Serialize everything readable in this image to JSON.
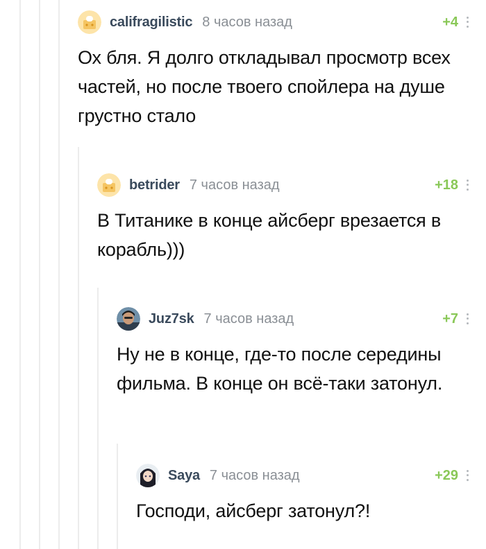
{
  "comments": [
    {
      "username": "califragilistic",
      "time": "8 часов назад",
      "rating": "+4",
      "text": "Ох бля. Я долго откладывал просмотр всех частей, но после твоего спойлера на душе грустно стало",
      "avatar": "default-avatar"
    },
    {
      "username": "betrider",
      "time": "7 часов назад",
      "rating": "+18",
      "text": "В Титанике в конце айсберг врезается в корабль)))",
      "avatar": "default-avatar"
    },
    {
      "username": "Juz7sk",
      "time": "7 часов назад",
      "rating": "+7",
      "text": "Ну не в конце, где-то после середины фильма. В конце он всё-таки затонул.",
      "avatar": "user-photo-avatar"
    },
    {
      "username": "Saya",
      "time": "7 часов назад",
      "rating": "+29",
      "text": "Господи, айсберг затонул?!",
      "avatar": "anime-avatar"
    }
  ],
  "colors": {
    "username": "#3a4a5c",
    "time": "#8a8f95",
    "rating_positive": "#8ac858",
    "thread_line": "#ececec"
  }
}
